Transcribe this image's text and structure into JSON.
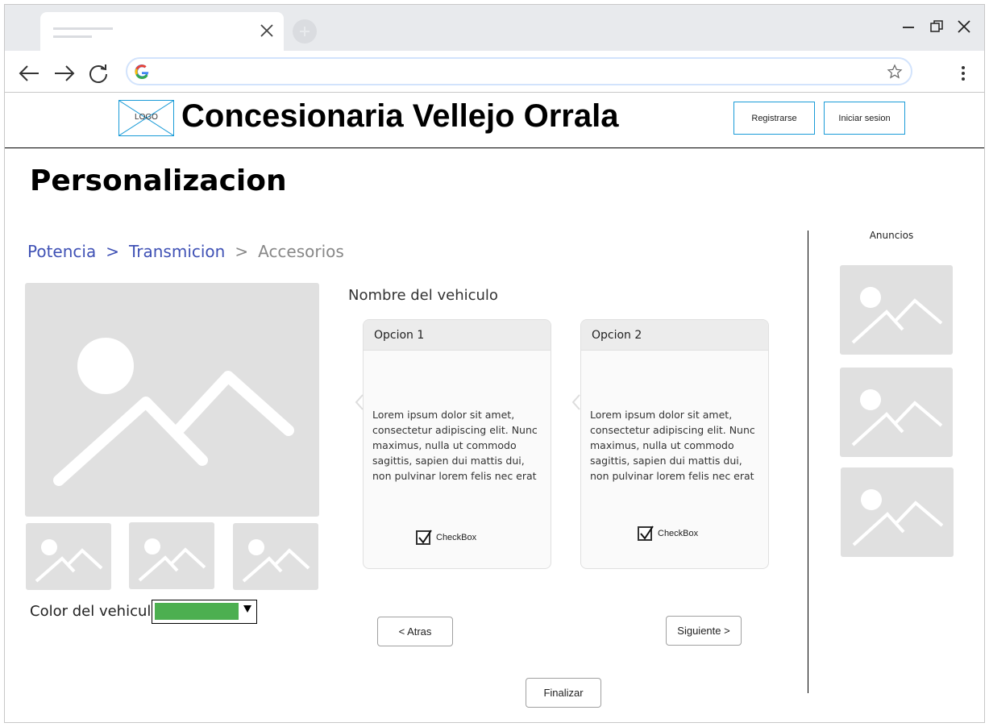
{
  "browser": {
    "address_value": "",
    "icons": {
      "back": "arrow-left-icon",
      "forward": "arrow-right-icon",
      "reload": "reload-icon",
      "google": "google-icon",
      "bookmark": "star-icon",
      "menu": "kebab-menu-icon"
    }
  },
  "header": {
    "logo_text": "LOGO",
    "site_title": "Concesionaria Vellejo Orrala",
    "register_label": "Registrarse",
    "login_label": "Iniciar sesion"
  },
  "page_title": "Personalizacion",
  "breadcrumb": {
    "items": [
      "Potencia",
      "Transmicion",
      "Accesorios"
    ],
    "separator": ">"
  },
  "vehicle": {
    "name_label": "Nombre del vehiculo",
    "color_label": "Color del vehiculo",
    "selected_color": "#4caf50"
  },
  "options": [
    {
      "title": "Opcion 1",
      "body": "Lorem ipsum dolor sit amet, consectetur adipiscing elit. Nunc maximus, nulla ut commodo sagittis, sapien dui mattis dui, non pulvinar lorem felis nec erat",
      "checkbox_label": "CheckBox",
      "checked": true
    },
    {
      "title": "Opcion 2",
      "body": "Lorem ipsum dolor sit amet, consectetur adipiscing elit. Nunc maximus, nulla ut commodo sagittis, sapien dui mattis dui, non pulvinar lorem felis nec erat",
      "checkbox_label": "CheckBox",
      "checked": true
    }
  ],
  "nav": {
    "back_label": "< Atras",
    "next_label": "Siguiente >",
    "finish_label": "Finalizar"
  },
  "ads": {
    "title": "Anuncios"
  },
  "colors": {
    "accent_link": "#3f51b5",
    "header_button_border": "#1a9bd7",
    "placeholder": "#e0e0e0"
  }
}
